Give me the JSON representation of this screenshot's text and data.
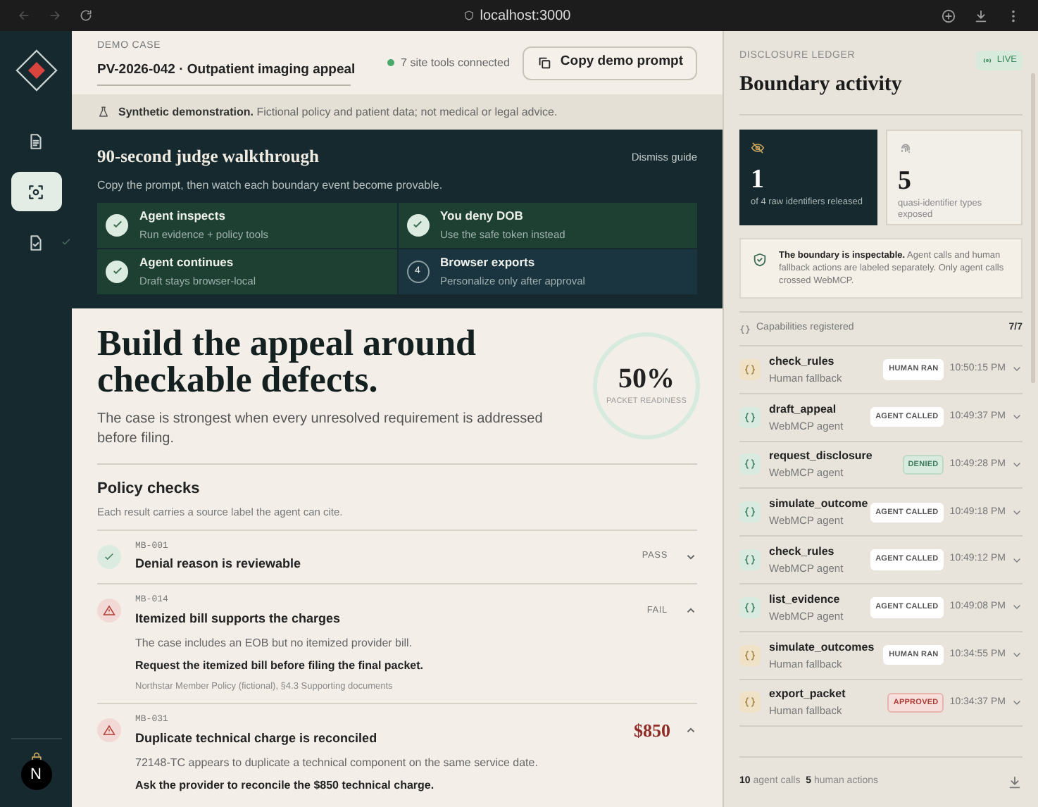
{
  "browser": {
    "url": "localhost:3000"
  },
  "rail": {
    "items": [
      {
        "kind": "document",
        "selected": false,
        "done": false
      },
      {
        "kind": "scan",
        "selected": true,
        "done": false
      },
      {
        "kind": "export",
        "selected": false,
        "done": true
      }
    ],
    "avatar": "N"
  },
  "header": {
    "eyebrow": "DEMO CASE",
    "case_title": "PV-2026-042 · Outpatient imaging appeal",
    "tools_status": "7 site tools connected",
    "copy_button": "Copy demo prompt"
  },
  "banner": {
    "text": "**Synthetic demonstration.** Fictional policy and patient data; not medical or legal advice."
  },
  "walkthrough": {
    "title": "90-second judge walkthrough",
    "subtitle": "Copy the prompt, then watch each boundary event become provable.",
    "dismiss": "Dismiss guide",
    "steps": [
      {
        "title": "Agent inspects",
        "detail": "Run evidence + policy tools",
        "done": true
      },
      {
        "title": "You deny DOB",
        "detail": "Use the safe token instead",
        "done": true
      },
      {
        "title": "Agent continues",
        "detail": "Draft stays browser-local",
        "done": true
      },
      {
        "title": "Browser exports",
        "detail": "Personalize only after approval",
        "done": false,
        "number": "4"
      }
    ]
  },
  "hero": {
    "title": "Build the appeal around checkable defects.",
    "lede": "The case is strongest when every unresolved requirement is addressed before filing.",
    "readiness": {
      "value": "50%",
      "label": "PACKET READINESS"
    }
  },
  "policy": {
    "title": "Policy checks",
    "subtitle": "Each result carries a source label the agent can cite.",
    "checks": [
      {
        "code": "MB-001",
        "title": "Denial reason is reviewable",
        "passed": true,
        "status": "PASS",
        "expanded": false
      },
      {
        "code": "MB-014",
        "title": "Itemized bill supports the charges",
        "passed": false,
        "status": "FAIL",
        "expanded": true,
        "finding": "The case includes an EOB but no itemized provider bill.",
        "action": "Request the itemized bill before filing the final packet.",
        "source": "Northstar Member Policy (fictional), §4.3 Supporting documents"
      },
      {
        "code": "MB-031",
        "title": "Duplicate technical charge is reconciled",
        "passed": false,
        "amount": "$850",
        "expanded": true,
        "finding": "72148-TC appears to duplicate a technical component on the same service date.",
        "action": "Ask the provider to reconcile the $850 technical charge."
      }
    ]
  },
  "ledger": {
    "eyebrow": "DISCLOSURE LEDGER",
    "title": "Boundary activity",
    "live": "LIVE",
    "stats": [
      {
        "kind": "raw",
        "value": "1",
        "label": "of 4 raw identifiers released"
      },
      {
        "kind": "quasi",
        "value": "5",
        "label": "quasi-identifier types exposed"
      }
    ],
    "notice": "**The boundary is inspectable.** Agent calls and human fallback actions are labeled separately. Only agent calls crossed WebMCP.",
    "capabilities": {
      "label": "Capabilities registered",
      "count": "7/7"
    },
    "events": [
      {
        "tool": "check_rules",
        "actor": "Human fallback",
        "kind": "human",
        "badge": {
          "label": "HUMAN RAN",
          "kind": "plain"
        },
        "time": "10:50:15 PM"
      },
      {
        "tool": "draft_appeal",
        "actor": "WebMCP agent",
        "kind": "agent",
        "badge": {
          "label": "AGENT CALLED",
          "kind": "plain"
        },
        "time": "10:49:37 PM"
      },
      {
        "tool": "request_disclosure",
        "actor": "WebMCP agent",
        "kind": "agent",
        "badge": {
          "label": "DENIED",
          "kind": "denied"
        },
        "time": "10:49:28 PM"
      },
      {
        "tool": "simulate_outcome",
        "actor": "WebMCP agent",
        "kind": "agent",
        "badge": {
          "label": "AGENT CALLED",
          "kind": "plain"
        },
        "time": "10:49:18 PM"
      },
      {
        "tool": "check_rules",
        "actor": "WebMCP agent",
        "kind": "agent",
        "badge": {
          "label": "AGENT CALLED",
          "kind": "plain"
        },
        "time": "10:49:12 PM"
      },
      {
        "tool": "list_evidence",
        "actor": "WebMCP agent",
        "kind": "agent",
        "badge": {
          "label": "AGENT CALLED",
          "kind": "plain"
        },
        "time": "10:49:08 PM"
      },
      {
        "tool": "simulate_outcomes",
        "actor": "Human fallback",
        "kind": "human",
        "badge": {
          "label": "HUMAN RAN",
          "kind": "plain"
        },
        "time": "10:34:55 PM"
      },
      {
        "tool": "export_packet",
        "actor": "Human fallback",
        "kind": "human",
        "badge": {
          "label": "APPROVED",
          "kind": "approved"
        },
        "time": "10:34:37 PM"
      }
    ],
    "footer": "**10** agent calls  **5** human actions"
  }
}
